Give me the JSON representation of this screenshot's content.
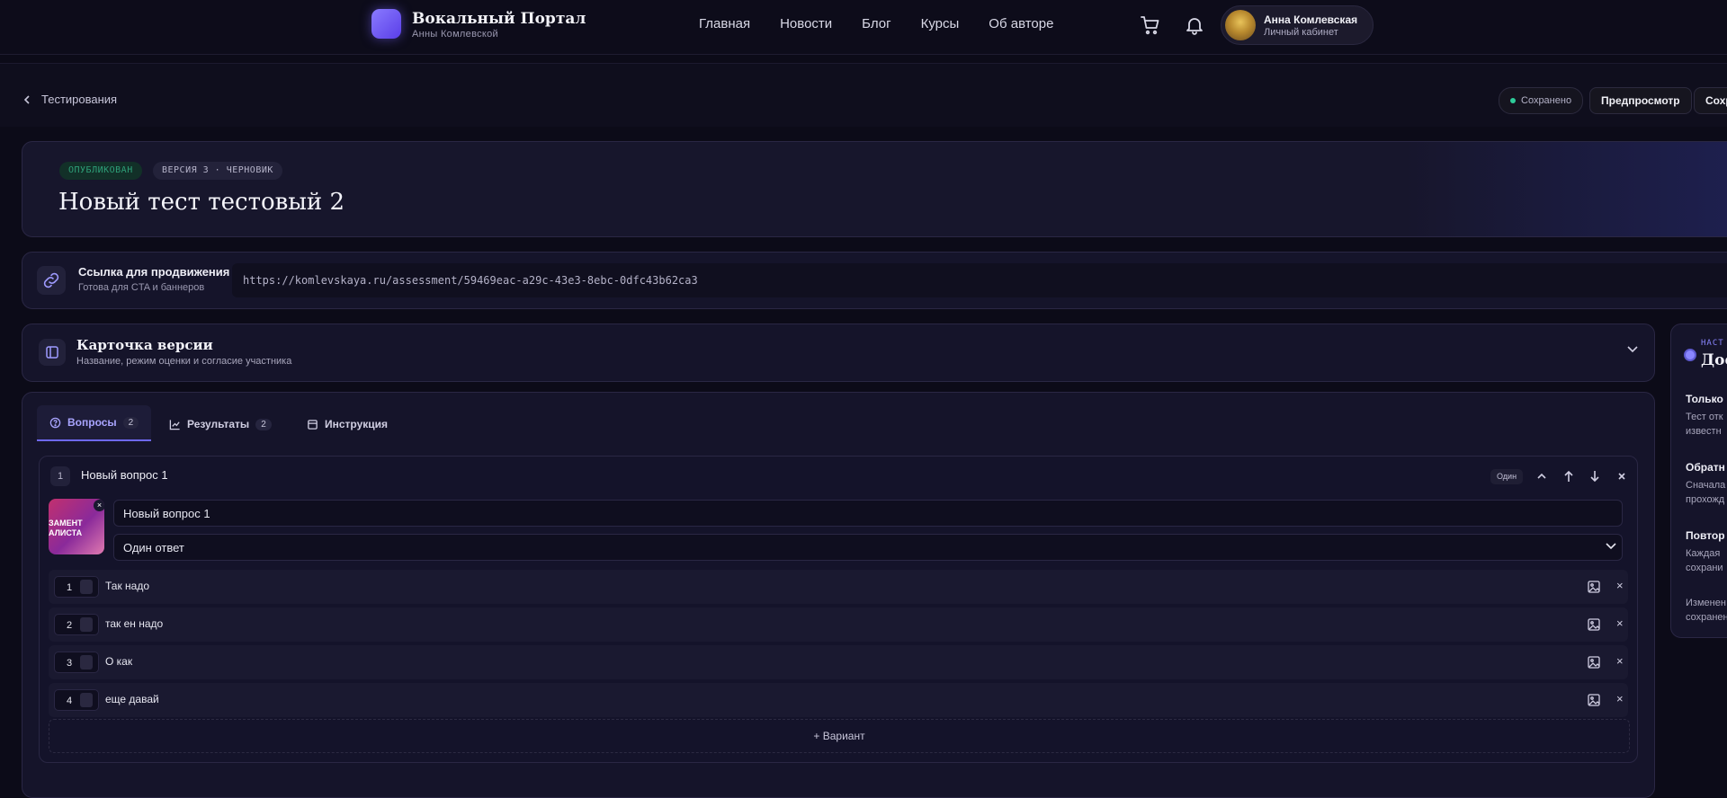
{
  "header": {
    "brand_title": "Вокальный Портал",
    "brand_sub": "Анны Комлевской",
    "nav": [
      "Главная",
      "Новости",
      "Блог",
      "Курсы",
      "Об авторе"
    ],
    "user_name": "Анна Комлевская",
    "user_sub": "Личный кабинет"
  },
  "toolbar": {
    "back_label": "Тестирования",
    "saved_label": "Сохранено",
    "preview_label": "Предпросмотр",
    "save_label": "Сохр"
  },
  "hero": {
    "status_tag": "ОПУБЛИКОВАН",
    "version_tag": "ВЕРСИЯ 3 · ЧЕРНОВИК",
    "title": "Новый тест тестовый 2"
  },
  "promo": {
    "title": "Ссылка для продвижения",
    "subtitle": "Готова для CTA и баннеров",
    "url": "https://komlevskaya.ru/assessment/59469eac-a29c-43e3-8ebc-0dfc43b62ca3"
  },
  "version_card": {
    "title": "Карточка версии",
    "subtitle": "Название, режим оценки и согласие участника"
  },
  "settings_panel": {
    "kicker": "НАСТ",
    "title": "Дос",
    "items": [
      {
        "heading": "Только",
        "text": [
          "Тест отк",
          "известн"
        ]
      },
      {
        "heading": "Обратн",
        "text": [
          "Сначала",
          "прохожд"
        ]
      },
      {
        "heading": "Повтор",
        "text": [
          "Каждая",
          "сохрани"
        ]
      },
      {
        "heading": "",
        "text": [
          "Изменен",
          "сохранен"
        ]
      }
    ]
  },
  "tabs": [
    {
      "label": "Вопросы",
      "count": "2"
    },
    {
      "label": "Результаты",
      "count": "2"
    },
    {
      "label": "Инструкция",
      "count": ""
    }
  ],
  "question": {
    "number": "1",
    "title": "Новый вопрос 1",
    "type_chip": "Один",
    "thumb_text": "ЗАМЕНТ\nАЛИСТА",
    "text_value": "Новый вопрос 1",
    "answer_mode": "Один ответ",
    "options": [
      {
        "num": "1",
        "text": "Так надо"
      },
      {
        "num": "2",
        "text": "так ен надо"
      },
      {
        "num": "3",
        "text": "О как"
      },
      {
        "num": "4",
        "text": "еще давай"
      }
    ],
    "add_variant_label": "+ Вариант"
  }
}
